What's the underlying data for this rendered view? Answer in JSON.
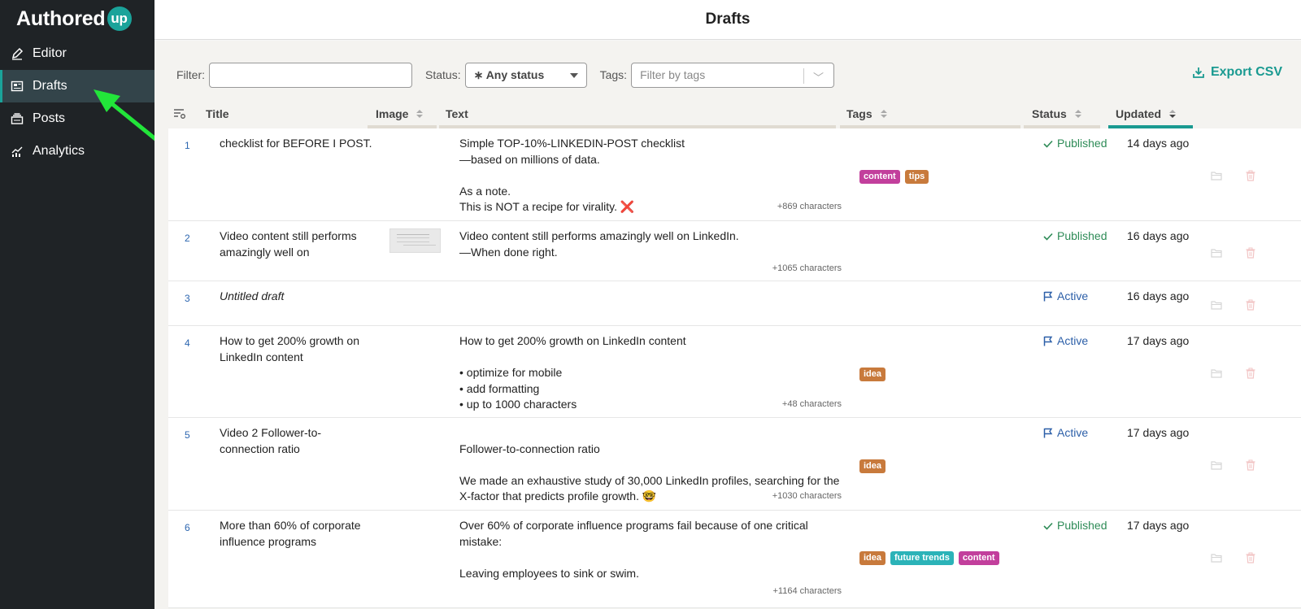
{
  "app": {
    "brand": "Authored",
    "brand_badge": "up",
    "page_title": "Drafts"
  },
  "sidebar": {
    "items": [
      {
        "label": "Editor",
        "icon": "pencil-icon",
        "active": false
      },
      {
        "label": "Drafts",
        "icon": "drafts-icon",
        "active": true
      },
      {
        "label": "Posts",
        "icon": "posts-icon",
        "active": false
      },
      {
        "label": "Analytics",
        "icon": "analytics-icon",
        "active": false
      }
    ]
  },
  "filters": {
    "filter_label": "Filter:",
    "filter_value": "",
    "status_label": "Status:",
    "status_value": "∗ Any status",
    "tags_label": "Tags:",
    "tags_placeholder": "Filter by tags",
    "export_label": "Export CSV"
  },
  "table": {
    "columns": {
      "title": "Title",
      "image": "Image",
      "text": "Text",
      "tags": "Tags",
      "status": "Status",
      "updated": "Updated"
    },
    "rows": [
      {
        "num": "1",
        "title": "checklist for BEFORE I POST.",
        "has_image": false,
        "text": "Simple TOP-10%-LINKEDIN-POST checklist\n—based on millions of data.\n\nAs a note.\nThis is NOT a recipe for virality. ❌",
        "chars": "+869 characters",
        "tags": [
          {
            "label": "content",
            "color": "#c23f9c"
          },
          {
            "label": "tips",
            "color": "#c87a3c"
          }
        ],
        "status": "Published",
        "status_kind": "published",
        "updated": "14 days ago"
      },
      {
        "num": "2",
        "title": "Video content still performs amazingly well on",
        "has_image": true,
        "text": "Video content still performs amazingly well on LinkedIn.\n—When done right.",
        "chars": "+1065 characters",
        "tags": [],
        "status": "Published",
        "status_kind": "published",
        "updated": "16 days ago"
      },
      {
        "num": "3",
        "title": "Untitled draft",
        "title_italic": true,
        "has_image": false,
        "text": "",
        "chars": "",
        "tags": [],
        "status": "Active",
        "status_kind": "active",
        "updated": "16 days ago"
      },
      {
        "num": "4",
        "title": "How to get 200% growth on LinkedIn content",
        "has_image": false,
        "text": "How to get 200% growth on LinkedIn content\n\n• optimize for mobile\n• add formatting\n• up to 1000 characters",
        "chars": "+48 characters",
        "tags": [
          {
            "label": "idea",
            "color": "#c87a3c"
          }
        ],
        "status": "Active",
        "status_kind": "active",
        "updated": "17 days ago"
      },
      {
        "num": "5",
        "title": "Video 2 Follower-to-connection ratio",
        "has_image": false,
        "text": "\nFollower-to-connection ratio\n\nWe made an exhaustive study of 30,000 LinkedIn profiles, searching for the X-factor that predicts profile growth. 🤓",
        "chars": "+1030 characters",
        "tags": [
          {
            "label": "idea",
            "color": "#c87a3c"
          }
        ],
        "status": "Active",
        "status_kind": "active",
        "updated": "17 days ago"
      },
      {
        "num": "6",
        "title": "More than 60% of corporate influence programs",
        "has_image": false,
        "text": "Over 60% of corporate influence programs fail because of one critical mistake:\n\nLeaving employees to sink or swim.",
        "chars": "+1164 characters",
        "tags": [
          {
            "label": "idea",
            "color": "#c87a3c"
          },
          {
            "label": "future trends",
            "color": "#2bb3b8"
          },
          {
            "label": "content",
            "color": "#c23f9c"
          }
        ],
        "status": "Published",
        "status_kind": "published",
        "updated": "17 days ago"
      }
    ]
  }
}
